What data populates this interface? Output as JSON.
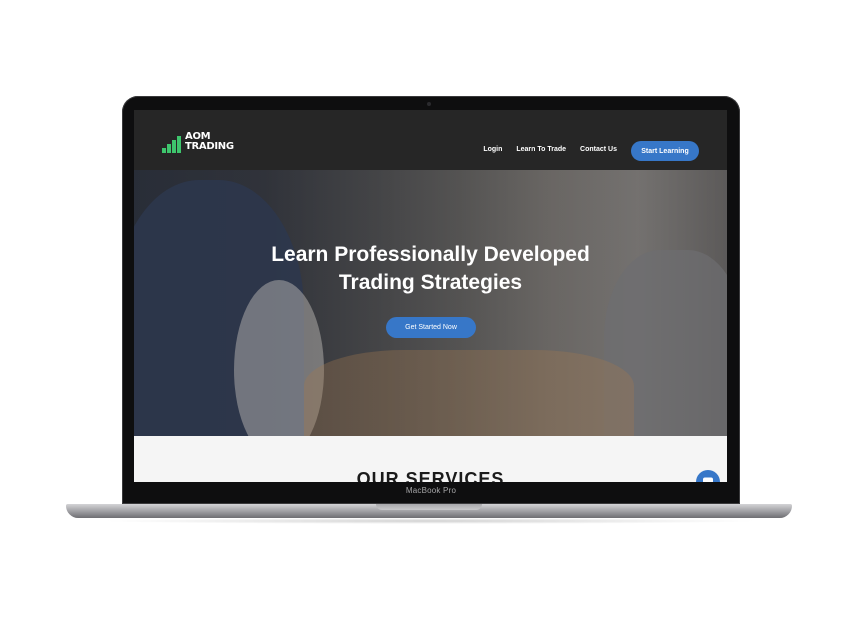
{
  "device": {
    "label": "MacBook Pro"
  },
  "site": {
    "logo": {
      "line1": "AOM",
      "line2": "TRADING"
    },
    "nav": {
      "items": [
        "Login",
        "Learn To Trade",
        "Contact Us"
      ],
      "cta_label": "Start Learning"
    },
    "hero": {
      "title_line1": "Learn Professionally Developed",
      "title_line2": "Trading Strategies",
      "cta_label": "Get Started Now"
    },
    "services": {
      "title": "OUR SERVICES"
    },
    "chat": {
      "icon": "chat-icon"
    }
  },
  "colors": {
    "header_bg": "#262626",
    "accent_blue": "#3777c8",
    "logo_green": "#3ec66d"
  }
}
